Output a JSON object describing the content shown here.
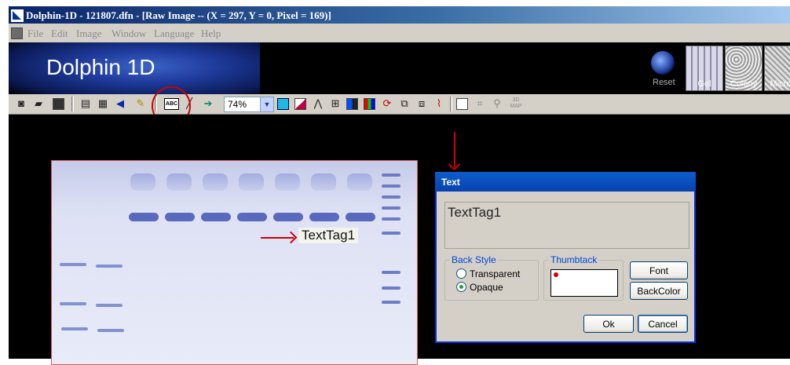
{
  "window": {
    "title": "Dolphin-1D - 121807.dfn - [Raw Image -- (X = 297, Y = 0, Pixel = 169)]"
  },
  "menu": [
    "File",
    "Edit",
    "Image",
    "Window",
    "Language",
    "Help"
  ],
  "banner": {
    "logo": "Dolphin 1D",
    "reset_label": "Reset",
    "modes": [
      "Gel",
      "Colony",
      "Micro"
    ]
  },
  "toolbar": {
    "icons": [
      "camera-icon",
      "open-folder-icon",
      "save-icon",
      "print-icon",
      "page-setup-icon",
      "arrow-tool-icon",
      "edit-icon",
      "text-tag-icon",
      "line-tool-icon",
      "export-icon",
      "fit-icon",
      "color-icon",
      "profile-icon",
      "grid-icon",
      "histogram-icon",
      "refresh-icon",
      "lane-icon",
      "band-icon",
      "waveform-icon",
      "select-rect-icon",
      "crop-icon",
      "magnify-icon",
      "3d-map-icon"
    ],
    "abc_label": "ABC",
    "zoom_value": "74%",
    "map_3d_label": "3D MAP"
  },
  "gel": {
    "text_tag": "TextTag1"
  },
  "dialog": {
    "title": "Text",
    "text_value": "TextTag1",
    "back_style_label": "Back Style",
    "transparent_label": "Transparent",
    "opaque_label": "Opaque",
    "selected_back_style": "Opaque",
    "thumbtack_label": "Thumbtack",
    "font_button": "Font",
    "backcolor_button": "BackColor",
    "ok_button": "Ok",
    "cancel_button": "Cancel"
  },
  "colors": {
    "title_blue": "#0a246a",
    "annotation_red": "#d00000",
    "dialog_border": "#0831d9"
  }
}
